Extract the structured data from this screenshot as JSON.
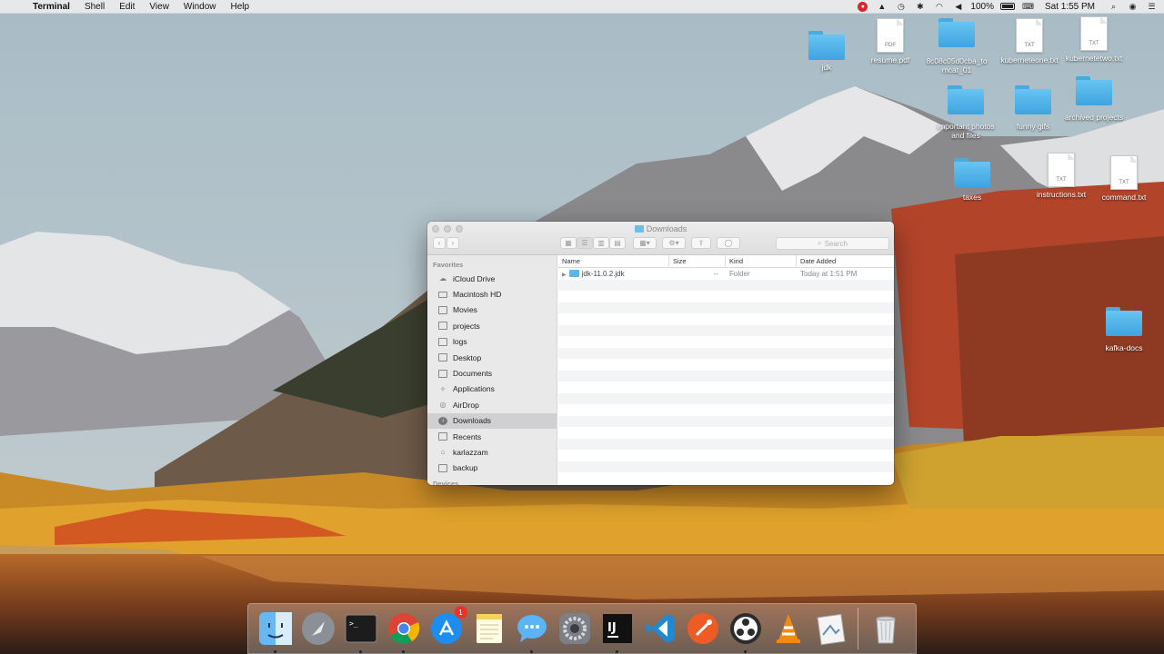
{
  "menubar": {
    "app_name": "Terminal",
    "menus": [
      "Shell",
      "Edit",
      "View",
      "Window",
      "Help"
    ],
    "battery": "100%",
    "clock": "Sat 1:55 PM"
  },
  "desktop_icons": [
    {
      "label": "jdk",
      "type": "folder"
    },
    {
      "label": "resume.pdf",
      "type": "document",
      "ext": "PDF"
    },
    {
      "label": "8c08c05d0cba_to\nmcat_01",
      "type": "folder"
    },
    {
      "label": "kuberneteone.txt",
      "type": "document",
      "ext": "TXT"
    },
    {
      "label": "kubernetetwo.txt",
      "type": "document",
      "ext": "TXT"
    },
    {
      "label": "important photos\nand files",
      "type": "folder"
    },
    {
      "label": "funny gifs",
      "type": "folder"
    },
    {
      "label": "archived projects",
      "type": "folder"
    },
    {
      "label": "taxes",
      "type": "folder"
    },
    {
      "label": "instructions.txt",
      "type": "document",
      "ext": "TXT"
    },
    {
      "label": "command.txt",
      "type": "document",
      "ext": "TXT"
    },
    {
      "label": "kafka-docs",
      "type": "folder"
    }
  ],
  "finder": {
    "title": "Downloads",
    "search_placeholder": "Search",
    "sidebar_header": "Favorites",
    "sidebar_items": [
      {
        "label": "iCloud Drive",
        "icon": "cloud-icon"
      },
      {
        "label": "Macintosh HD",
        "icon": "disk-icon"
      },
      {
        "label": "Movies",
        "icon": "folder-icon"
      },
      {
        "label": "projects",
        "icon": "folder-icon"
      },
      {
        "label": "logs",
        "icon": "folder-icon"
      },
      {
        "label": "Desktop",
        "icon": "folder-icon"
      },
      {
        "label": "Documents",
        "icon": "folder-icon"
      },
      {
        "label": "Applications",
        "icon": "applications-icon"
      },
      {
        "label": "AirDrop",
        "icon": "airdrop-icon"
      },
      {
        "label": "Downloads",
        "icon": "downloads-icon"
      },
      {
        "label": "Recents",
        "icon": "recents-icon"
      },
      {
        "label": "karlazzam",
        "icon": "home-icon"
      },
      {
        "label": "backup",
        "icon": "folder-icon"
      }
    ],
    "sidebar_devices_header": "Devices",
    "columns": {
      "name": "Name",
      "size": "Size",
      "kind": "Kind",
      "date": "Date Added"
    },
    "rows": [
      {
        "name": "jdk-11.0.2.jdk",
        "size": "--",
        "kind": "Folder",
        "date": "Today at 1:51 PM"
      }
    ]
  },
  "dock": {
    "apps": [
      "Finder",
      "Launchpad",
      "Terminal",
      "Google Chrome",
      "App Store",
      "Notes",
      "Messages",
      "System Preferences",
      "IntelliJ IDEA",
      "Visual Studio Code",
      "Postman",
      "OBS",
      "VLC",
      "Preview"
    ],
    "app_store_badge": "1",
    "trash": "Trash"
  }
}
